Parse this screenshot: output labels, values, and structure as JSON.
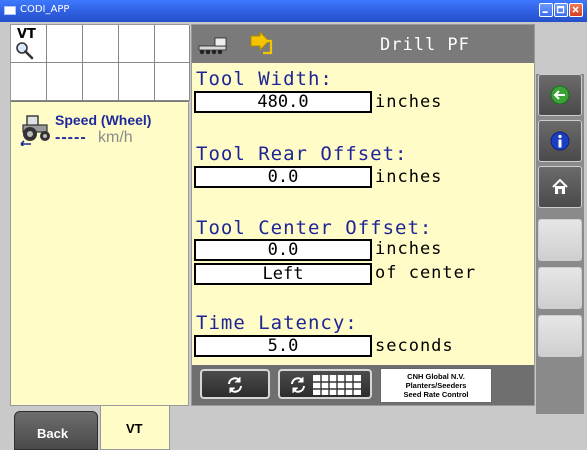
{
  "window": {
    "title": "CODI_APP"
  },
  "left_panel": {
    "grid_label": "VT",
    "speed_label": "Speed (Wheel)",
    "speed_value": "-----",
    "speed_unit": "km/h"
  },
  "header": {
    "drill_name": "Drill PF"
  },
  "settings": {
    "tool_width": {
      "label": "Tool Width:",
      "value": "480.0",
      "unit": "inches"
    },
    "tool_rear_offset": {
      "label": "Tool Rear Offset:",
      "value": "0.0",
      "unit": "inches"
    },
    "tool_center_offset": {
      "label": "Tool Center Offset:",
      "value": "0.0",
      "unit": "inches",
      "side_value": "Left",
      "side_unit": "of center"
    },
    "time_latency": {
      "label": "Time Latency:",
      "value": "5.0",
      "unit": "seconds"
    }
  },
  "footer": {
    "credit_line1": "CNH Global N.V.",
    "credit_line2": "Planters/Seeders",
    "credit_line3": "Seed Rate Control"
  },
  "tabs": {
    "back_label": "Back",
    "vt_label": "VT"
  },
  "colors": {
    "panel_bg": "#fffcc8",
    "label_blue": "#1e2596",
    "accent_yellow": "#f5c400",
    "green_icon": "#3aa335",
    "info_blue": "#1b3fc4"
  },
  "icons": {
    "tool_icon": "seeder-implement-icon",
    "arrow_icon": "arrow-into-icon",
    "tractor_icon": "tractor-icon",
    "magnifier_icon": "magnifier-icon",
    "return_icon": "green-return-icon",
    "info_icon": "info-icon",
    "home_icon": "home-icon",
    "refresh_icon": "refresh-icon",
    "refresh_grid_icon": "refresh-grid-icon"
  }
}
